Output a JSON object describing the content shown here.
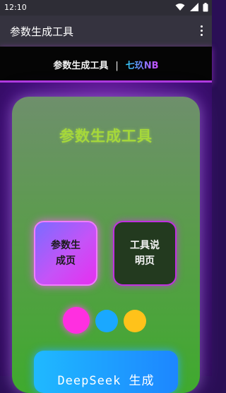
{
  "status_bar": {
    "time": "12:10",
    "icons": [
      "wifi-icon",
      "signal-icon",
      "battery-icon"
    ]
  },
  "app_bar": {
    "title": "参数生成工具",
    "menu_icon": "more-vert-icon"
  },
  "header": {
    "title": "参数生成工具",
    "separator": "|",
    "brand": "七玖NB"
  },
  "card": {
    "title": "参数生成工具",
    "tiles": [
      {
        "label": "参数生成页"
      },
      {
        "label": "工具说明页"
      }
    ],
    "theme_dots": [
      {
        "color": "#ff2fe0"
      },
      {
        "color": "#1aa8ff"
      },
      {
        "color": "#ffc21a"
      }
    ],
    "deepseek_label": "DeepSeek 生成"
  },
  "colors": {
    "accent_purple": "#b03ae0",
    "card_green": "#3faa2e",
    "title_green": "#a6d83a",
    "button_blue": "#1d86ff"
  }
}
